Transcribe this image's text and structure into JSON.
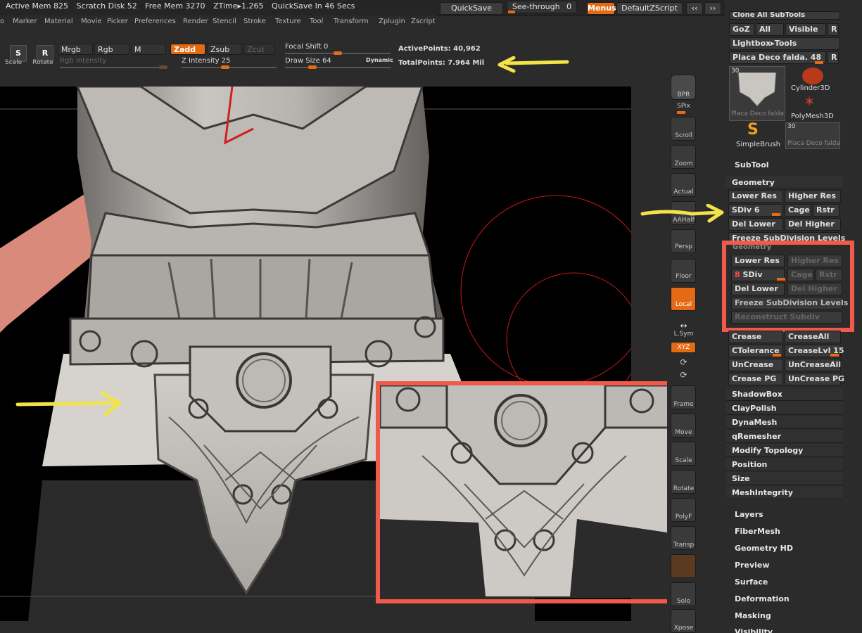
{
  "topbar": {
    "active_mem": "Active Mem 825",
    "scratch_disk": "Scratch Disk 52",
    "free_mem": "Free Mem 3270",
    "ztime": "ZTime▸1.265",
    "quicksave_in": "QuickSave In 46 Secs",
    "quicksave_btn": "QuickSave",
    "see_through_label": "See-through",
    "see_through_value": "0",
    "menus_btn": "Menus",
    "script_btn": "DefaultZScript"
  },
  "menubar": [
    "o",
    "Marker",
    "Material",
    "Movie",
    "Picker",
    "Preferences",
    "Render",
    "Stencil",
    "Stroke",
    "Texture",
    "Tool",
    "Transform",
    "Zplugin",
    "Zscript"
  ],
  "toolrow": {
    "scale": "Scale",
    "rotate": "Rotate",
    "mrgb": "Mrgb",
    "rgb": "Rgb",
    "m": "M",
    "zadd": "Zadd",
    "zsub": "Zsub",
    "zcut": "Zcut",
    "rgb_intensity": "Rgb Intensity",
    "z_intensity": "Z Intensity 25",
    "focal_shift": "Focal Shift 0",
    "draw_size": "Draw Size 64",
    "dynamic": "Dynamic",
    "active_points": "ActivePoints: 40,962",
    "total_points": "TotalPoints: 7.964 Mil"
  },
  "shelf": [
    "BPR",
    "SPix",
    "Scroll",
    "Zoom",
    "Actual",
    "AAHalf",
    "Persp",
    "Floor",
    "Local",
    "L.Sym",
    "XYZ",
    "Frame",
    "Move",
    "Scale",
    "Rotate",
    "PolyF",
    "Transp",
    "Solo",
    "Xpose"
  ],
  "rpanel": {
    "clone_all": "Clone All SubTools",
    "goz": "GoZ",
    "all": "All",
    "visible": "Visible",
    "r": "R",
    "lightbox": "Lightbox▸Tools",
    "placa_slider": "Placa Deco falda. 48",
    "thumb_count": "30",
    "thumb1_label": "Placa Deco falda",
    "thumb2_label": "Cylinder3D",
    "thumb3_label": "PolyMesh3D",
    "thumb4_label": "SimpleBrush",
    "thumb5_label": "Placa Deco falda",
    "subtool": "SubTool",
    "geometry": "Geometry",
    "lower_res": "Lower Res",
    "higher_res": "Higher Res",
    "sdiv": "SDiv 6",
    "cage": "Cage",
    "rstr": "Rstr",
    "del_lower": "Del Lower",
    "del_higher": "Del Higher",
    "freeze": "Freeze SubDivision Levels",
    "crease": "Crease",
    "crease_all": "CreaseAll",
    "ctolerance": "CTolerance",
    "crease_lvl": "CreaseLvl 15",
    "uncrease": "UnCrease",
    "uncrease_all": "UnCreaseAll",
    "crease_pg": "Crease PG",
    "uncrease_pg": "UnCrease PG",
    "shadowbox": "ShadowBox",
    "claypolish": "ClayPolish",
    "dynamesh": "DynaMesh",
    "qremesher": "qRemesher",
    "modify_topology": "Modify Topology",
    "position": "Position",
    "size": "Size",
    "meshintegrity": "MeshIntegrity",
    "sections": [
      "Layers",
      "FiberMesh",
      "Geometry HD",
      "Preview",
      "Surface",
      "Deformation",
      "Masking",
      "Visibility"
    ]
  },
  "inset": {
    "geometry": "Geometry",
    "lower_res": "Lower Res",
    "higher_res": "Higher Res",
    "sdiv_num": "8",
    "sdiv": "SDiv",
    "cage": "Cage",
    "rstr": "Rstr",
    "del_lower": "Del Lower",
    "del_higher": "Del Higher",
    "freeze": "Freeze SubDivision Levels",
    "reconstruct": "Reconstruct Subdiv"
  },
  "colors": {
    "accent": "#e46a14",
    "highlight_box": "#f05a4a",
    "annotation_arrow": "#f2e34a"
  }
}
